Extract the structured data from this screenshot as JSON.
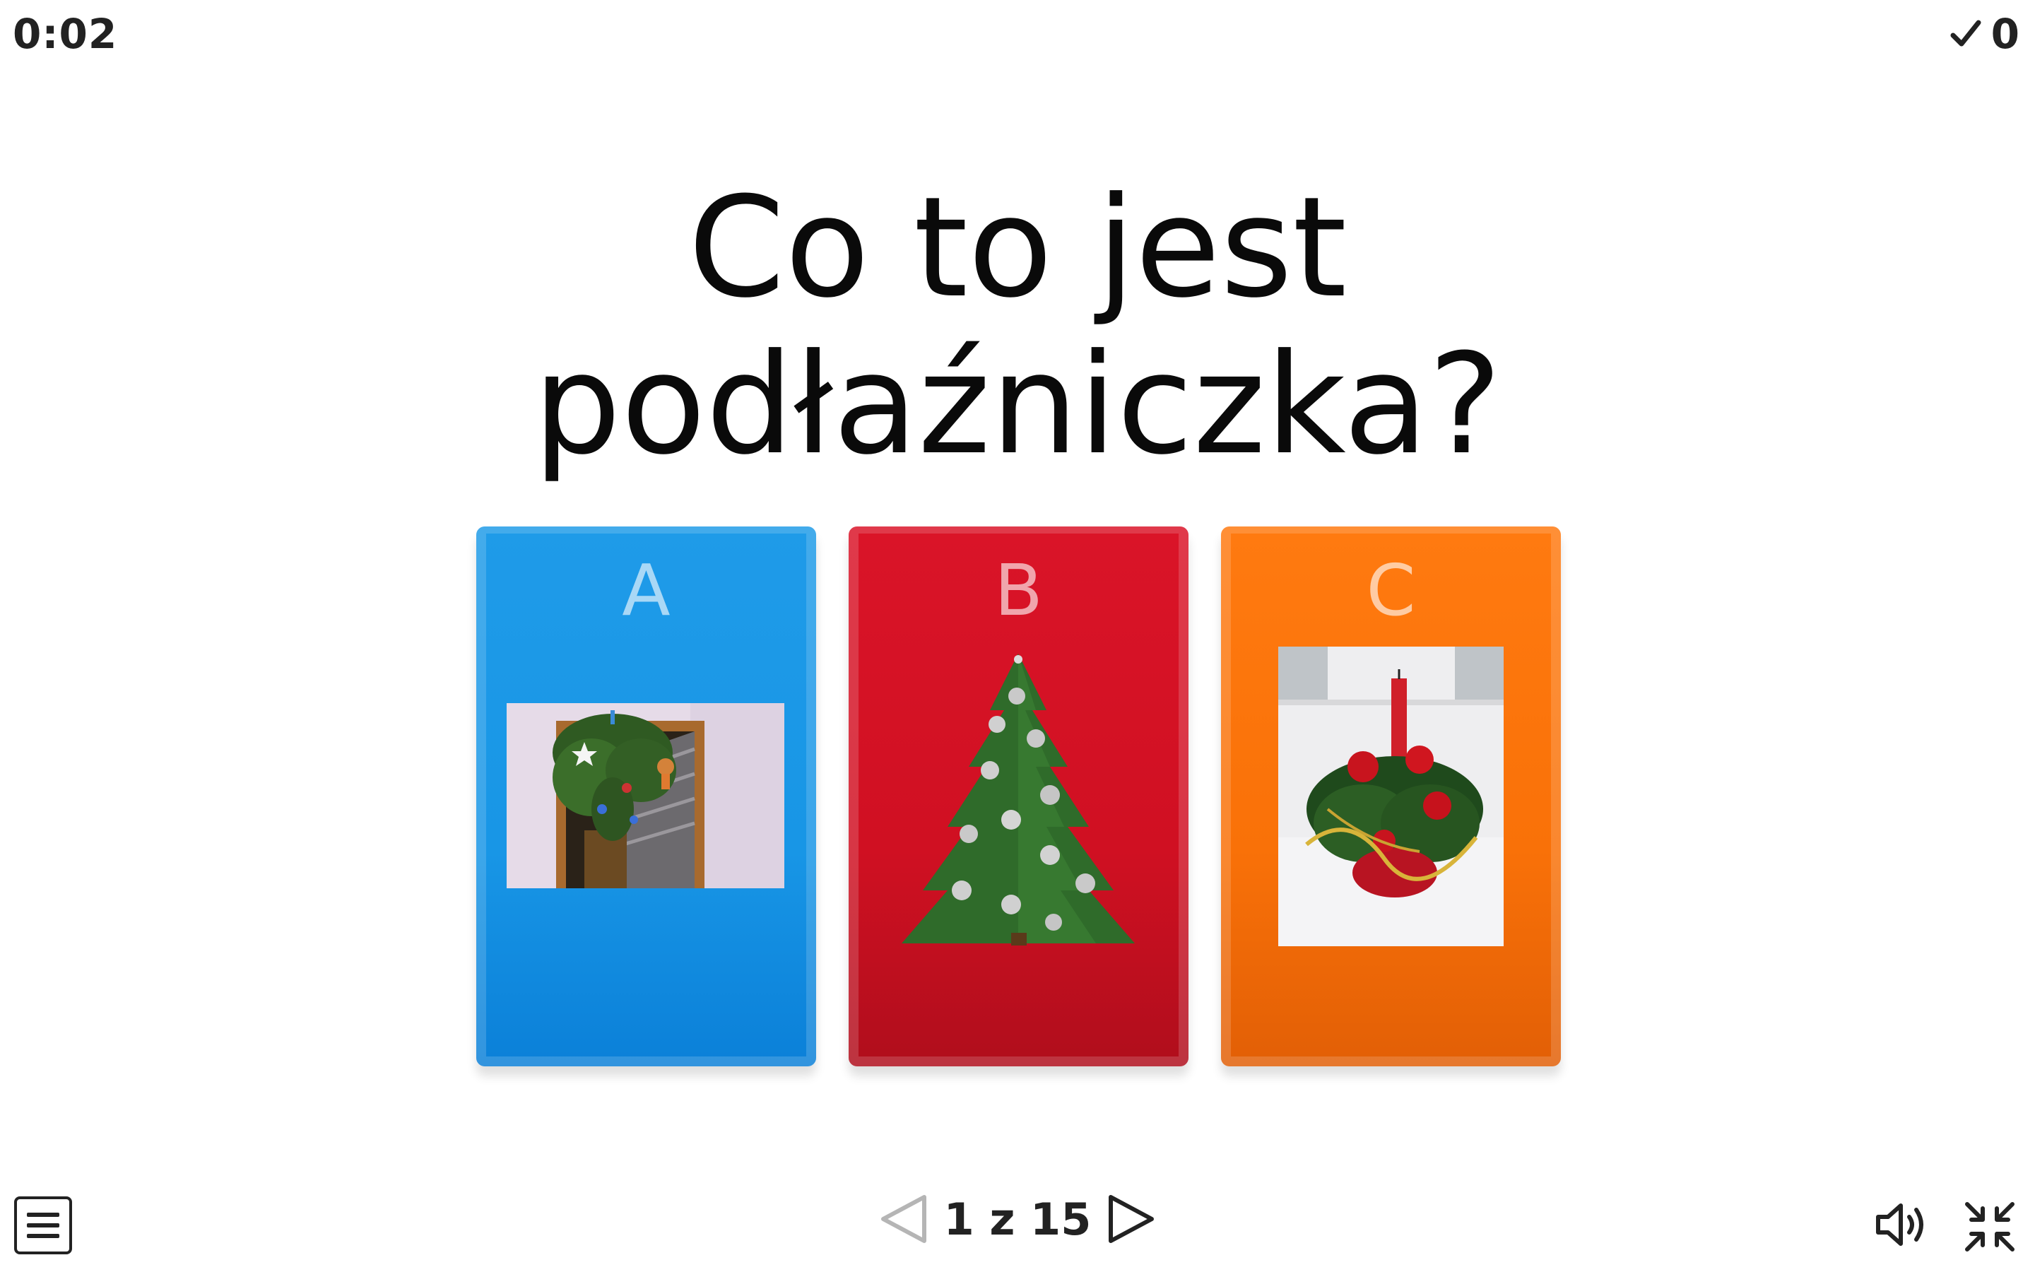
{
  "header": {
    "timer": "0:02",
    "score": "0",
    "score_icon": "check-icon"
  },
  "question": {
    "line1": "Co to jest",
    "line2": "podłaźniczka?"
  },
  "answers": [
    {
      "letter": "A",
      "color": "#1896e6",
      "image": "hanging-decorated-branch-photo"
    },
    {
      "letter": "B",
      "color": "#d01022",
      "image": "christmas-tree-image"
    },
    {
      "letter": "C",
      "color": "#f97108",
      "image": "candle-centerpiece-photo"
    }
  ],
  "footer": {
    "menu_icon": "menu-icon",
    "page_text": "1 z 15",
    "prev_icon": "triangle-left-icon",
    "next_icon": "triangle-right-icon",
    "sound_icon": "speaker-icon",
    "fullscreen_icon": "exit-fullscreen-icon"
  }
}
